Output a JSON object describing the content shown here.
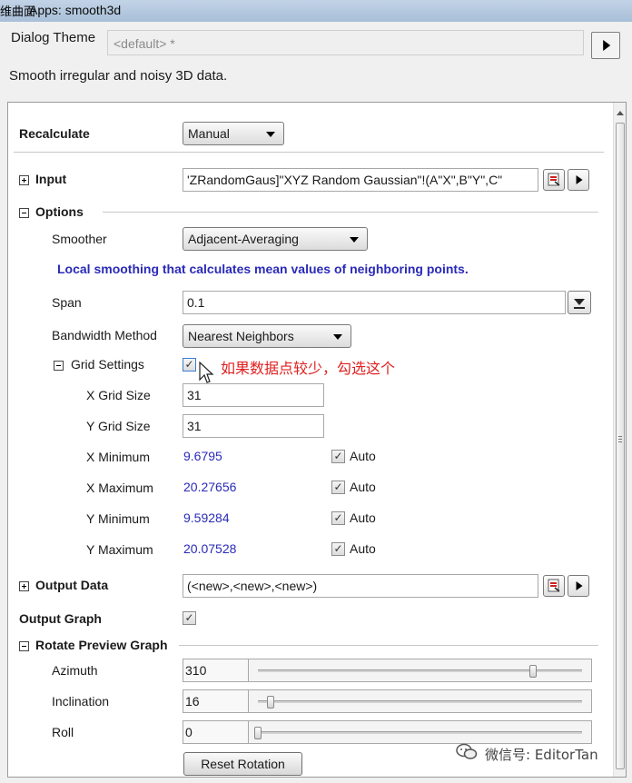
{
  "window": {
    "title_cut": "维曲面",
    "title": "Apps: smooth3d"
  },
  "dialog_theme": {
    "label": "Dialog Theme",
    "value": "<default> *"
  },
  "description": "Smooth irregular and noisy 3D data.",
  "recalculate": {
    "label": "Recalculate",
    "value": "Manual"
  },
  "input": {
    "label": "Input",
    "value": "'ZRandomGaus]\"XYZ Random Gaussian\"!(A\"X\",B\"Y\",C\""
  },
  "options": {
    "label": "Options",
    "smoother": {
      "label": "Smoother",
      "value": "Adjacent-Averaging"
    },
    "smoother_note": "Local smoothing that calculates mean values of neighboring points.",
    "span": {
      "label": "Span",
      "value": "0.1"
    },
    "bandwidth": {
      "label": "Bandwidth Method",
      "value": "Nearest Neighbors"
    },
    "grid": {
      "label": "Grid Settings",
      "checked": "✓",
      "x_size": {
        "label": "X Grid Size",
        "value": "31"
      },
      "y_size": {
        "label": "Y Grid Size",
        "value": "31"
      },
      "x_min": {
        "label": "X Minimum",
        "value": "9.6795",
        "auto": "Auto"
      },
      "x_max": {
        "label": "X Maximum",
        "value": "20.27656",
        "auto": "Auto"
      },
      "y_min": {
        "label": "Y Minimum",
        "value": "9.59284",
        "auto": "Auto"
      },
      "y_max": {
        "label": "Y Maximum",
        "value": "20.07528",
        "auto": "Auto"
      }
    }
  },
  "output_data": {
    "label": "Output Data",
    "value": "(<new>,<new>,<new>)"
  },
  "output_graph": {
    "label": "Output Graph",
    "checked": "✓"
  },
  "rotate": {
    "label": "Rotate Preview Graph",
    "azimuth": {
      "label": "Azimuth",
      "value": "310",
      "fraction": 0.85
    },
    "inclination": {
      "label": "Inclination",
      "value": "16",
      "fraction": 0.04
    },
    "roll": {
      "label": "Roll",
      "value": "0",
      "fraction": 0.0
    },
    "reset_label": "Reset Rotation"
  },
  "annotation": "如果数据点较少，勾选这个",
  "watermark": "微信号: EditorTan",
  "colors": {
    "accent_blue": "#2a2ab8",
    "annotation_red": "#e02020"
  }
}
